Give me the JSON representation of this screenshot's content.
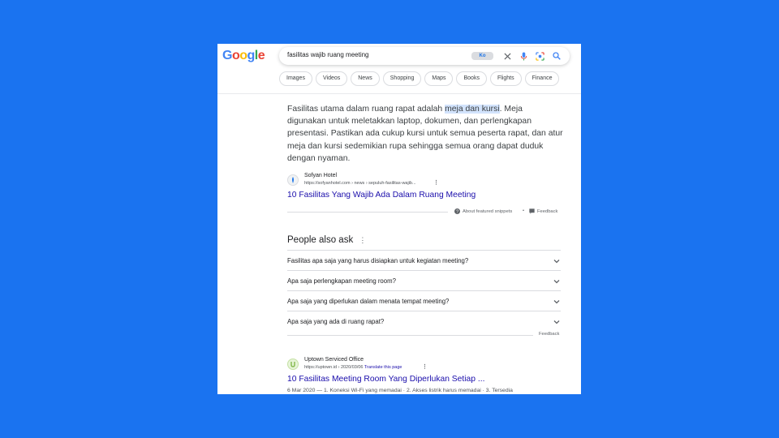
{
  "logo": {
    "letters": [
      "G",
      "o",
      "o",
      "g",
      "l",
      "e"
    ],
    "colors": [
      "#4285f4",
      "#ea4335",
      "#fbbc05",
      "#4285f4",
      "#34a853",
      "#ea4335"
    ]
  },
  "search": {
    "query": "fasilitas wajib ruang meeting",
    "keyboard_badge": "Ko"
  },
  "chips": [
    "Images",
    "Videos",
    "News",
    "Shopping",
    "Maps",
    "Books",
    "Flights",
    "Finance"
  ],
  "featured": {
    "text_before": "Fasilitas utama dalam ruang rapat adalah ",
    "highlight": "meja dan kursi",
    "text_after": ". Meja digunakan untuk meletakkan laptop, dokumen, dan perlengkapan presentasi. Pastikan ada cukup kursi untuk semua peserta rapat, dan atur meja dan kursi sedemikian rupa sehingga semua orang dapat duduk dengan nyaman.",
    "source_name": "Sofyan Hotel",
    "source_url": "https://sofyanhotel.com › news › sepuluh-fasilitas-wajib...",
    "title": "10 Fasilitas Yang Wajib Ada Dalam Ruang Meeting",
    "about_link": "About featured snippets",
    "separator": "•",
    "feedback": "Feedback"
  },
  "paa": {
    "title": "People also ask",
    "questions": [
      "Fasilitas apa saja yang harus disiapkan untuk kegiatan meeting?",
      "Apa saja perlengkapan meeting room?",
      "Apa saja yang diperlukan dalam menata tempat meeting?",
      "Apa saja yang ada di ruang rapat?"
    ],
    "feedback": "Feedback"
  },
  "result2": {
    "source_name": "Uptown Serviced Office",
    "source_url": "https://uptown.id › 2020/03/06",
    "translate": "Translate this page",
    "title": "10 Fasilitas Meeting Room Yang Diperlukan Setiap ...",
    "snippet": "6 Mar 2020 — 1. Koneksi Wi-Fi yang memadai · 2. Akses listrik harus memadai · 3. Tersedia"
  },
  "colors": {
    "background": "#1a73f0",
    "link": "#1a0dab",
    "highlight": "#d2e3fc"
  },
  "icons": [
    "clear-icon",
    "microphone-icon",
    "lens-icon",
    "search-icon",
    "more-vert-icon",
    "help-icon",
    "feedback-icon",
    "chevron-down-icon"
  ]
}
